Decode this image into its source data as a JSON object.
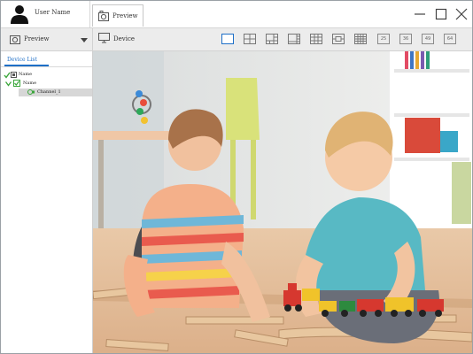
{
  "header": {
    "user_name": "User Name",
    "tab_label": "Preview",
    "window_controls": {
      "minimize": "minimize-icon",
      "maximize": "maximize-icon",
      "close": "close-icon"
    }
  },
  "toolbar": {
    "mode_select": {
      "value": "Preview"
    },
    "device_label": "Device",
    "layouts": {
      "icons": [
        "layout-1-icon",
        "layout-4-icon",
        "layout-6-icon",
        "layout-8-icon",
        "layout-9-icon",
        "layout-13-icon",
        "layout-16-icon"
      ],
      "numbered": [
        "25",
        "36",
        "49",
        "64"
      ],
      "active": "layout-1-icon"
    }
  },
  "sidebar": {
    "tab_label": "Device List",
    "tree": [
      {
        "label": "Name",
        "level": 0
      },
      {
        "label": "Name",
        "level": 1
      },
      {
        "label": "Channel_1",
        "level": 2,
        "selected": true
      }
    ]
  },
  "colors": {
    "accent": "#1e6fc7",
    "check": "#3aa63a"
  }
}
